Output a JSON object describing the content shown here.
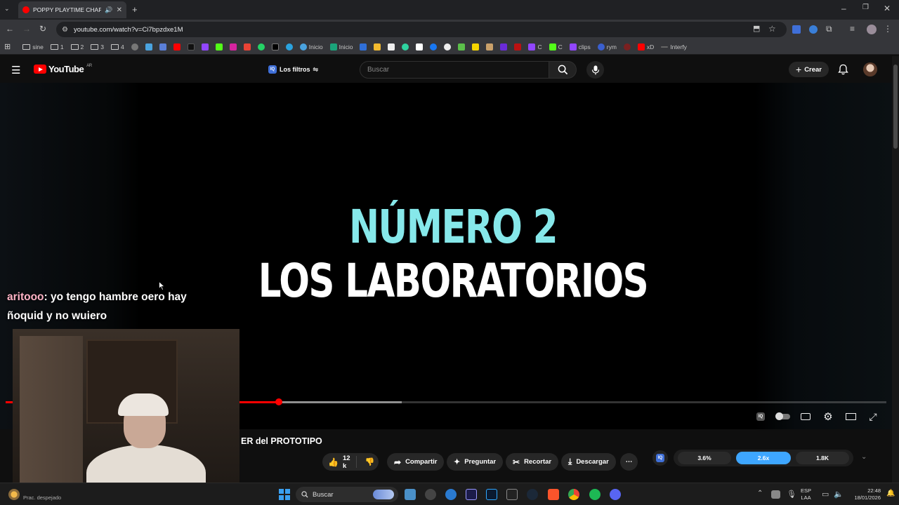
{
  "browser": {
    "tab_title": "POPPY PLAYTIME CHAPTER",
    "url": "youtube.com/watch?v=Ci7bpzdxe1M",
    "bookmarks": [
      "sine",
      "1",
      "2",
      "3",
      "4",
      "Inicio",
      "Inicio",
      "C",
      "C",
      "clips",
      "rym",
      "xD",
      "Interfy"
    ]
  },
  "youtube": {
    "logo": "YouTube",
    "region": "AR",
    "filters_label": "Los filtros",
    "search_placeholder": "Buscar",
    "create_label": "Crear"
  },
  "video": {
    "overlay_line1": "NÚMERO 2",
    "overlay_line2": "LOS LABORATORIOS",
    "progress_played": 0.31,
    "progress_buffered": 0.45,
    "title_fragment": "ER del PROTOTIPO"
  },
  "chat": {
    "user": "aritooo",
    "message": ": yo tengo hambre oero hay ñoquid y no wuiero"
  },
  "actions": {
    "likes": "12 k",
    "share": "Compartir",
    "ask": "Preguntar",
    "clip": "Recortar",
    "download": "Descargar"
  },
  "extension_stats": {
    "s1": "3.6%",
    "s2": "2.6x",
    "s3": "1.8K"
  },
  "taskbar": {
    "weather": "Prac. despejado",
    "search": "Buscar",
    "lang1": "ESP",
    "lang2": "LAA",
    "time": "22:48",
    "date": "18/01/2026"
  },
  "colors": {
    "accent_red": "#ff0000",
    "title_cyan": "#86e8ea",
    "stat_highlight": "#3ea6ff"
  }
}
